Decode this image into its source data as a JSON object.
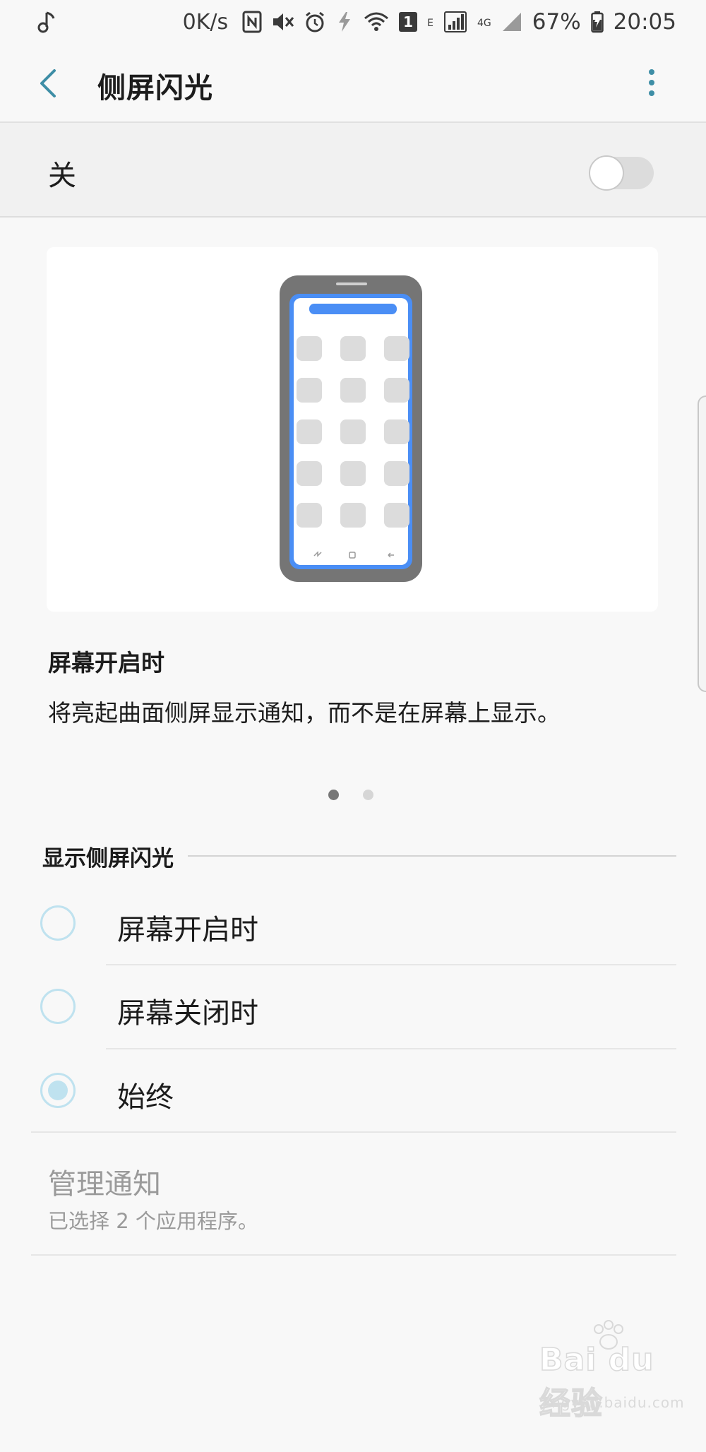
{
  "status_bar": {
    "net_speed": "0K/s",
    "data_type": "E",
    "network": "4G",
    "sim_slot": "1",
    "battery": "67%",
    "time": "20:05",
    "icons": [
      "music-note-icon",
      "nfc-icon",
      "mute-icon",
      "alarm-icon",
      "data-saver-icon",
      "wifi-icon",
      "signal-icon",
      "battery-charging-icon"
    ]
  },
  "app_bar": {
    "title": "侧屏闪光",
    "back_icon": "chevron-left-icon",
    "more_icon": "more-vertical-icon"
  },
  "master_switch": {
    "label": "关",
    "enabled": false
  },
  "illustration": {
    "grid_rows": 5,
    "grid_cols": 3,
    "accent_color": "#4a8ef5"
  },
  "description": {
    "title": "屏幕开启时",
    "text": "将亮起曲面侧屏显示通知，而不是在屏幕上显示。",
    "page_count": 2,
    "active_page": 1
  },
  "section": {
    "title": "显示侧屏闪光",
    "options": [
      {
        "label": "屏幕开启时",
        "selected": false
      },
      {
        "label": "屏幕关闭时",
        "selected": false
      },
      {
        "label": "始终",
        "selected": true
      }
    ]
  },
  "manage": {
    "title": "管理通知",
    "subtitle": "已选择 2 个应用程序。"
  },
  "watermark": {
    "main": "Bai du 经验",
    "sub": "jingyan.baidu.com"
  },
  "colors": {
    "accent": "#3e8ea6",
    "radio": "#bfe2ef",
    "phone_highlight": "#4a8ef5"
  }
}
